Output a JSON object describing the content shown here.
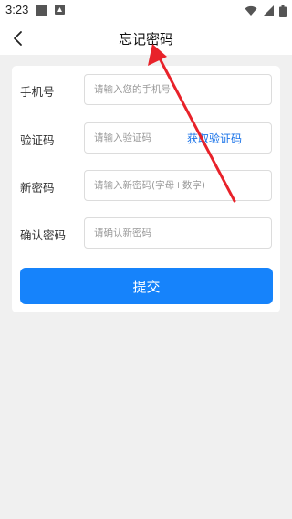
{
  "status_bar": {
    "time": "3:23"
  },
  "header": {
    "title": "忘记密码",
    "back_icon": "chevron-left-icon"
  },
  "form": {
    "fields": [
      {
        "label": "手机号",
        "placeholder": "请输入您的手机号",
        "value": ""
      },
      {
        "label": "验证码",
        "placeholder": "请输入验证码",
        "value": ""
      },
      {
        "label": "新密码",
        "placeholder": "请输入新密码(字母+数字)",
        "value": ""
      },
      {
        "label": "确认密码",
        "placeholder": "请确认新密码",
        "value": ""
      }
    ],
    "get_code_label": "获取验证码",
    "submit_label": "提交"
  },
  "colors": {
    "accent": "#1683fb",
    "link": "#1a73e8",
    "annotation": "#e8222a",
    "background": "#f0f0f0"
  }
}
